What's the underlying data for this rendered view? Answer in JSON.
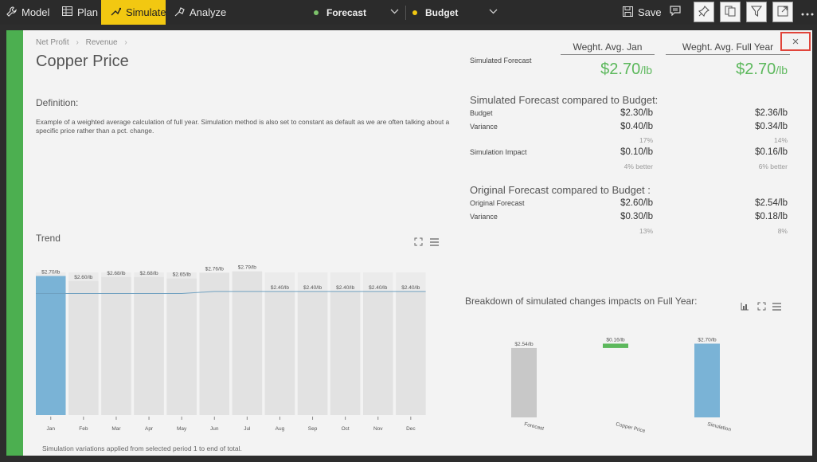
{
  "toolbar": {
    "model": "Model",
    "plan": "Plan",
    "simulate": "Simulate",
    "analyze": "Analyze",
    "forecast": "Forecast",
    "budget": "Budget",
    "save": "Save",
    "forecast_color": "#7dc36b",
    "budget_color": "#f2c811",
    "active_color": "#f2c811"
  },
  "panel": {
    "breadcrumb": [
      "Net Profit",
      "Revenue"
    ],
    "title": "Copper Price",
    "definition_label": "Definition:",
    "definition_text": "Example of a weighted average calculation of full year. Simulation method is also set to constant as default as we are often talking about a specific price rather than a pct. change.",
    "accent_color": "#4caf50",
    "close_label": "×"
  },
  "metrics": {
    "col_jan": "Weght. Avg. Jan",
    "col_full": "Weght. Avg. Full Year",
    "simulated_forecast_label": "Simulated Forecast",
    "sim_jan": "$2.70",
    "sim_full": "$2.70",
    "unit": "/lb",
    "section1": "Simulated Forecast compared to Budget:",
    "budget_label": "Budget",
    "budget_jan": "$2.30/lb",
    "budget_full": "$2.36/lb",
    "variance_label": "Variance",
    "variance_jan": "$0.40/lb",
    "variance_full": "$0.34/lb",
    "variance_pct_jan": "17%",
    "variance_pct_full": "14%",
    "impact_label": "Simulation Impact",
    "impact_jan": "$0.10/lb",
    "impact_full": "$0.16/lb",
    "impact_note_jan": "4% better",
    "impact_note_full": "6% better",
    "section2": "Original Forecast compared to Budget :",
    "orig_label": "Original Forecast",
    "orig_jan": "$2.60/lb",
    "orig_full": "$2.54/lb",
    "variance2_label": "Variance",
    "variance2_jan": "$0.30/lb",
    "variance2_full": "$0.18/lb",
    "variance2_pct_jan": "13%",
    "variance2_pct_full": "8%"
  },
  "trend": {
    "title": "Trend",
    "footnote": "Simulation variations applied from selected period 1 to end of total."
  },
  "breakdown": {
    "title": "Breakdown of simulated changes impacts on Full Year:"
  },
  "chart_data": [
    {
      "type": "bar",
      "title": "Trend",
      "categories": [
        "Jan",
        "Feb",
        "Mar",
        "Apr",
        "May",
        "Jun",
        "Jul",
        "Aug",
        "Sep",
        "Oct",
        "Nov",
        "Dec"
      ],
      "values": [
        2.7,
        2.6,
        2.68,
        2.68,
        2.65,
        2.76,
        2.79,
        2.4,
        2.4,
        2.4,
        2.4,
        2.4
      ],
      "value_labels": [
        "$2.70/lb",
        "$2.60/lb",
        "$2.68/lb",
        "$2.68/lb",
        "$2.65/lb",
        "$2.76/lb",
        "$2.79/lb",
        "$2.40/lb",
        "$2.40/lb",
        "$2.40/lb",
        "$2.40/lb",
        "$2.40/lb"
      ],
      "highlighted_index": 0,
      "bar_color": "#7ab3d6",
      "other_bar_color": "#e2e2e2",
      "line": {
        "name": "",
        "values": [
          2.36,
          2.36,
          2.36,
          2.36,
          2.36,
          2.4,
          2.4,
          2.4,
          2.4,
          2.4,
          2.4,
          2.4
        ],
        "color": "#6fa0c0"
      },
      "ylim": [
        0,
        2.8
      ]
    },
    {
      "type": "bar",
      "title": "Breakdown of simulated changes impacts on Full Year:",
      "categories": [
        "Forecast",
        "Copper Price",
        "Simulation"
      ],
      "values": [
        2.54,
        0.16,
        2.7
      ],
      "value_labels": [
        "$2.54/lb",
        "$0.16/lb",
        "$2.70/lb"
      ],
      "colors": [
        "#c8c8c8",
        "#5cb85c",
        "#7ab3d6"
      ],
      "waterfall": true,
      "ylim": [
        0,
        2.8
      ]
    }
  ]
}
